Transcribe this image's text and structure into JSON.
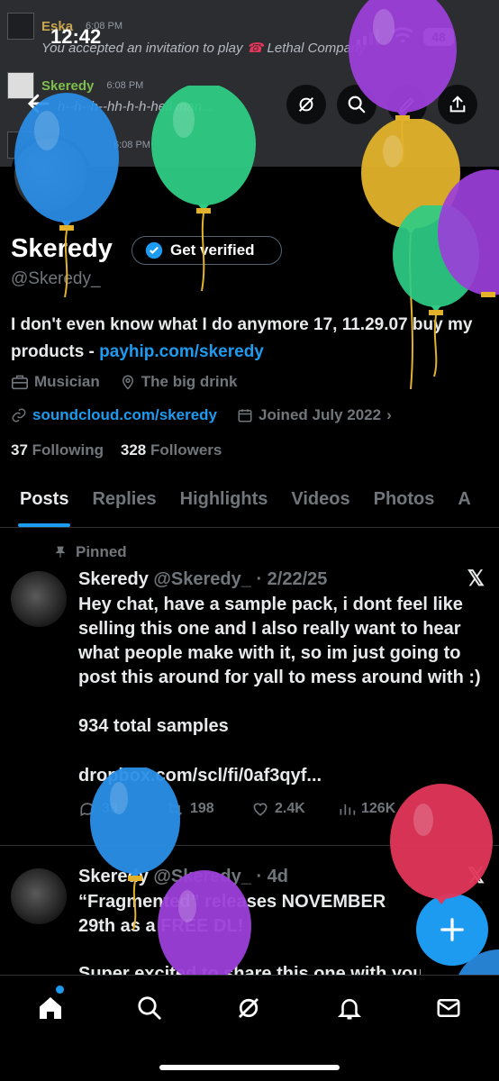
{
  "status_bar": {
    "time": "12:42",
    "battery": "48"
  },
  "banner": {
    "messages": [
      {
        "user": "Eska",
        "time": "6:08 PM",
        "text": "You accepted an invitation to play",
        "game": "Lethal Company"
      },
      {
        "user": "Skeredy",
        "time": "6:08 PM",
        "text": "h--h--h--hh-h-h-hell man..."
      },
      {
        "time": "6:08 PM"
      }
    ]
  },
  "profile": {
    "name": "Skeredy",
    "get_verified": "Get verified",
    "handle": "@Skeredy_",
    "bio_text": "I don't even know what I do anymore 17, 11.29.07 buy my products - ",
    "bio_link": "payhip.com/skeredy",
    "profession": "Musician",
    "location": "The big drink",
    "website": "soundcloud.com/skeredy",
    "joined": "Joined July 2022",
    "following_count": "37",
    "following_label": "Following",
    "followers_count": "328",
    "followers_label": "Followers"
  },
  "tabs": [
    "Posts",
    "Replies",
    "Highlights",
    "Videos",
    "Photos",
    "A"
  ],
  "posts": [
    {
      "pinned_label": "Pinned",
      "name": "Skeredy",
      "handle": "@Skeredy_",
      "date": "· 2/22/25",
      "body": "Hey chat, have a sample pack, i dont feel like selling this one and I also really want to hear what people make with it, so im just going to post this around for yall to mess around with :)",
      "body2": "934 total samples",
      "link": "dropbox.com/scl/fi/0af3qyf...",
      "replies": "38",
      "reposts": "198",
      "likes": "2.4K",
      "views": "126K"
    },
    {
      "name": "Skeredy",
      "handle": "@Skeredy_",
      "date": "· 4d",
      "body": "“Fragmented” releases NOVEMBER 29th as a FREE DL!",
      "body2": "Super excited to share this one with you all"
    }
  ],
  "icons": {
    "back": "arrow-left-icon",
    "grok": "grok-icon",
    "search": "search-icon",
    "edit": "pen-icon",
    "share": "share-icon",
    "x_logo": "x-logo-icon",
    "compose": "plus-icon"
  },
  "colors": {
    "accent": "#1d9bf0",
    "background": "#000000",
    "muted": "#71767b",
    "balloon_blue": "#2a8fe8",
    "balloon_green": "#2ecc85",
    "balloon_purple": "#9b3fd9",
    "balloon_yellow": "#e3b22a",
    "balloon_red": "#e2365a"
  }
}
